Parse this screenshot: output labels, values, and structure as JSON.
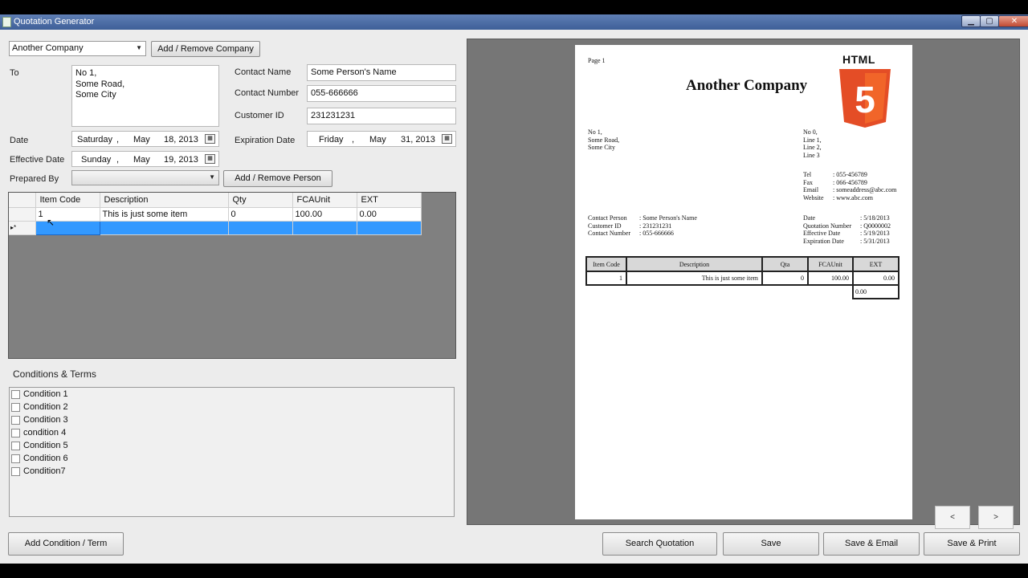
{
  "window": {
    "title": "Quotation Generator",
    "controls": [
      "▁",
      "▢",
      "✕"
    ]
  },
  "company_select": {
    "value": "Another Company",
    "add_remove_label": "Add / Remove Company"
  },
  "to": {
    "label": "To",
    "lines": [
      "No 1,",
      "Some Road,",
      "Some City"
    ]
  },
  "contact": {
    "name_label": "Contact Name",
    "name_value": "Some Person's Name",
    "number_label": "Contact Number",
    "number_value": "055-666666",
    "customer_id_label": "Customer ID",
    "customer_id_value": "231231231"
  },
  "dates": {
    "date_label": "Date",
    "date": {
      "weekday": "Saturday",
      "month": "May",
      "day_year": "18, 2013"
    },
    "expiration_label": "Expiration Date",
    "expiration": {
      "weekday": "Friday",
      "month": "May",
      "day_year": "31, 2013"
    },
    "effective_label": "Effective Date",
    "effective": {
      "weekday": "Sunday",
      "month": "May",
      "day_year": "19, 2013"
    },
    "sep": ","
  },
  "prepared_by": {
    "label": "Prepared By",
    "value": "",
    "add_remove_label": "Add / Remove Person"
  },
  "items_grid": {
    "columns": [
      "Item Code",
      "Description",
      "Qty",
      "FCAUnit",
      "EXT"
    ],
    "rows": [
      [
        "1",
        "This is just some item",
        "0",
        "100.00",
        "0.00"
      ]
    ],
    "new_row_marker": "▸*"
  },
  "conditions": {
    "heading": "Conditions & Terms",
    "items": [
      "Condition 1",
      "Condition 2",
      "Condition 3",
      "condition 4",
      "Condition 5",
      "Condition 6",
      "Condition7"
    ]
  },
  "preview": {
    "page_label": "Page 1",
    "company_name": "Another Company",
    "logo_text": "HTML",
    "logo_number": "5",
    "to_lines": [
      "No 1,",
      "Some Road,",
      "Some City"
    ],
    "from_lines": [
      "No 0,",
      "Line 1,",
      "Line 2,",
      "Line 3"
    ],
    "contact_info": [
      {
        "k": "Tel",
        "v": ": 055-456789"
      },
      {
        "k": "Fax",
        "v": ": 066-456789"
      },
      {
        "k": "Email",
        "v": ": someaddress@abc.com"
      },
      {
        "k": "Website",
        "v": ": www.abc.com"
      }
    ],
    "customer_info": [
      {
        "k": "Contact Person",
        "v": ": Some Person's Name"
      },
      {
        "k": "Customer ID",
        "v": ": 231231231"
      },
      {
        "k": "Contact Number",
        "v": ": 055-666666"
      }
    ],
    "quote_info": [
      {
        "k": "Date",
        "v": ": 5/18/2013"
      },
      {
        "k": "Quotation Number",
        "v": ": Q0000002"
      },
      {
        "k": "Effective Date",
        "v": ": 5/19/2013"
      },
      {
        "k": "Expiration Date",
        "v": ": 5/31/2013"
      }
    ],
    "table_headers": [
      "Item Code",
      "Description",
      "Qta",
      "FCAUnit",
      "EXT"
    ],
    "table_row": [
      "1",
      "This is just some item",
      "0",
      "100.00",
      "0.00"
    ],
    "total": "0.00",
    "prev_label": "<",
    "next_label": ">"
  },
  "buttons": {
    "add_condition": "Add Condition / Term",
    "search": "Search Quotation",
    "save": "Save",
    "save_email": "Save & Email",
    "save_print": "Save & Print"
  },
  "colors": {
    "titlebar": "#4a6aa5",
    "selection": "#3399ff",
    "logo_orange": "#e44d26"
  }
}
